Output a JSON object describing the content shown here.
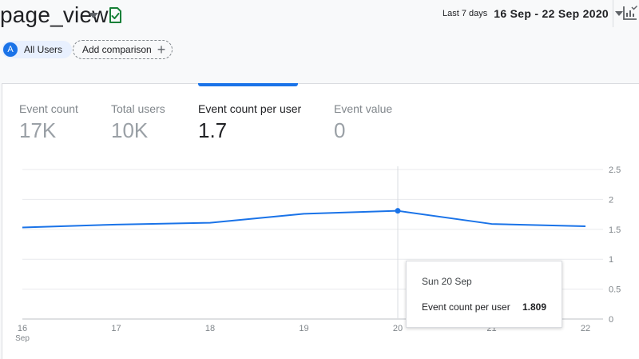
{
  "header": {
    "title": "page_view",
    "date_range_label": "Last 7 days",
    "date_range_value": "16 Sep - 22 Sep 2020",
    "icons": [
      "chevron-down-icon",
      "verified-check-icon",
      "chevron-down-icon",
      "insights-chart-icon"
    ]
  },
  "filters": {
    "users_avatar": "A",
    "users_label": "All Users",
    "compare_label": "Add comparison",
    "compare_icon": "+"
  },
  "metrics": [
    {
      "label": "Event count",
      "value": "17K"
    },
    {
      "label": "Total users",
      "value": "10K"
    },
    {
      "label": "Event count per user",
      "value": "1.7"
    },
    {
      "label": "Event value",
      "value": "0"
    }
  ],
  "chart_data": {
    "type": "line",
    "x": [
      "16",
      "17",
      "18",
      "19",
      "20",
      "21",
      "22"
    ],
    "x_sub": [
      "Sep",
      "",
      "",
      "",
      "",
      "",
      ""
    ],
    "series": [
      {
        "values": [
          1.53,
          1.58,
          1.61,
          1.76,
          1.809,
          1.59,
          1.55
        ]
      }
    ],
    "y_ticks": [
      "2.5",
      "2",
      "1.5",
      "1",
      "0.5",
      "0"
    ],
    "ylim": [
      0,
      2.5
    ],
    "grid": true,
    "line_color": "#1a73e8",
    "highlight_index": 4
  },
  "tooltip": {
    "date": "Sun 20 Sep",
    "label": "Event count per user",
    "value": "1.809"
  },
  "colors": {
    "accent": "#1a73e8",
    "verified": "#188038"
  }
}
